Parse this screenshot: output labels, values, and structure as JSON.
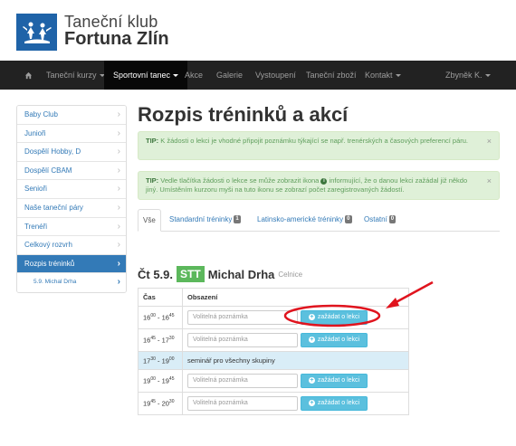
{
  "header": {
    "logo_line1": "Taneční klub",
    "logo_line2": "Fortuna Zlín",
    "brand_color": "#1f63a8"
  },
  "nav": {
    "home_icon": "home-icon",
    "items": [
      {
        "label": "Taneční kurzy",
        "dropdown": true
      },
      {
        "label": "Sportovní tanec",
        "dropdown": true,
        "active": true
      },
      {
        "label": "Akce"
      },
      {
        "label": "Galerie"
      },
      {
        "label": "Vystoupení"
      },
      {
        "label": "Taneční zboží"
      },
      {
        "label": "Kontakt",
        "dropdown": true
      }
    ],
    "user": "Zbyněk K."
  },
  "sidebar": {
    "items": [
      {
        "label": "Baby Club"
      },
      {
        "label": "Junioři"
      },
      {
        "label": "Dospělí Hobby, D"
      },
      {
        "label": "Dospělí CBAM"
      },
      {
        "label": "Senioři"
      },
      {
        "label": "Naše taneční páry"
      },
      {
        "label": "Trenéři"
      },
      {
        "label": "Celkový rozvrh"
      },
      {
        "label": "Rozpis tréninků",
        "active": true
      },
      {
        "label": "5.9. Michal Drha",
        "sub": true
      }
    ]
  },
  "main": {
    "title": "Rozpis tréninků a akcí",
    "alerts": [
      {
        "tip": "TIP:",
        "text_before": "K žádosti o lekci je vhodné připojit poznámku týkající se např. trenérských a časových preferencí páru.",
        "text_after": ""
      },
      {
        "tip": "TIP:",
        "text_before": "Vedle tlačítka žádosti o lekce se může zobrazit ikona",
        "text_after": "informující, že o danou lekci zažádal již někdo jiný. Umístěním kurzoru myši na tuto ikonu se zobrazí počet zaregistrovaných žádostí."
      }
    ],
    "close_symbol": "×",
    "tabs": [
      {
        "label": "Vše",
        "active": true
      },
      {
        "label": "Standardní tréninky",
        "badge": "1"
      },
      {
        "label": "Latinsko-americké tréninky",
        "badge": "0"
      },
      {
        "label": "Ostatní",
        "badge": "0"
      }
    ],
    "day": {
      "date": "Čt 5.9.",
      "badge": "STT",
      "coach": "Michal Drha",
      "venue": "Celnice"
    },
    "table": {
      "headers": [
        "Čas",
        "Obsazení"
      ],
      "rows": [
        {
          "from_h": "16",
          "from_m": "00",
          "to_h": "16",
          "to_m": "45",
          "placeholder": "Volitelná poznámka",
          "button": "zažádat o lekci"
        },
        {
          "from_h": "16",
          "from_m": "45",
          "to_h": "17",
          "to_m": "30",
          "placeholder": "Volitelná poznámka",
          "button": "zažádat o lekci"
        },
        {
          "from_h": "17",
          "from_m": "30",
          "to_h": "19",
          "to_m": "00",
          "info": "seminář pro všechny skupiny"
        },
        {
          "from_h": "19",
          "from_m": "00",
          "to_h": "19",
          "to_m": "45",
          "placeholder": "Volitelná poznámka",
          "button": "zažádat o lekci"
        },
        {
          "from_h": "19",
          "from_m": "45",
          "to_h": "20",
          "to_m": "30",
          "placeholder": "Volitelná poznámka",
          "button": "zažádat o lekci"
        }
      ]
    }
  },
  "colors": {
    "navbar": "#222222",
    "primary": "#337ab7",
    "info_button": "#5bc0de",
    "success": "#5cb85c",
    "annotation": "#e0141e"
  }
}
